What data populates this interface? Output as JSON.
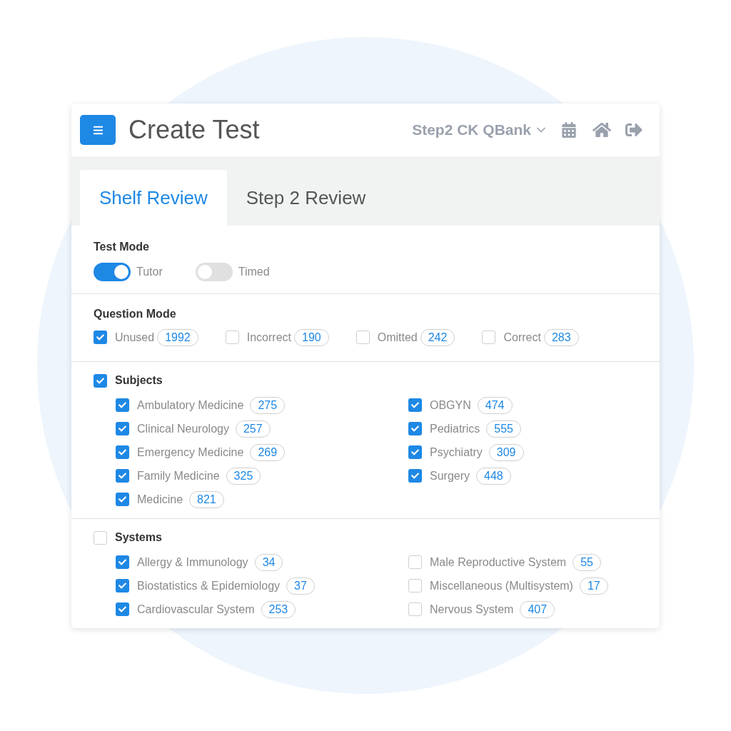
{
  "header": {
    "title": "Create Test",
    "qbank_selector": "Step2 CK QBank"
  },
  "tabs": [
    {
      "label": "Shelf Review",
      "selected": true
    },
    {
      "label": "Step 2 Review",
      "selected": false
    }
  ],
  "test_mode": {
    "label": "Test Mode",
    "options": [
      {
        "label": "Tutor",
        "on": true
      },
      {
        "label": "Timed",
        "on": false
      }
    ]
  },
  "question_mode": {
    "label": "Question Mode",
    "options": [
      {
        "label": "Unused",
        "count": "1992",
        "checked": true
      },
      {
        "label": "Incorrect",
        "count": "190",
        "checked": false
      },
      {
        "label": "Omitted",
        "count": "242",
        "checked": false
      },
      {
        "label": "Correct",
        "count": "283",
        "checked": false
      }
    ]
  },
  "groups": [
    {
      "label": "Subjects",
      "checked": true,
      "columns": [
        [
          {
            "label": "Ambulatory Medicine",
            "count": "275",
            "checked": true
          },
          {
            "label": "Clinical Neurology",
            "count": "257",
            "checked": true
          },
          {
            "label": "Emergency Medicine",
            "count": "269",
            "checked": true
          },
          {
            "label": "Family Medicine",
            "count": "325",
            "checked": true
          },
          {
            "label": "Medicine",
            "count": "821",
            "checked": true
          }
        ],
        [
          {
            "label": "OBGYN",
            "count": "474",
            "checked": true
          },
          {
            "label": "Pediatrics",
            "count": "555",
            "checked": true
          },
          {
            "label": "Psychiatry",
            "count": "309",
            "checked": true
          },
          {
            "label": "Surgery",
            "count": "448",
            "checked": true
          }
        ]
      ]
    },
    {
      "label": "Systems",
      "checked": false,
      "columns": [
        [
          {
            "label": "Allergy & Immunology",
            "count": "34",
            "checked": true
          },
          {
            "label": "Biostatistics & Epidemiology",
            "count": "37",
            "checked": true
          },
          {
            "label": "Cardiovascular System",
            "count": "253",
            "checked": true
          }
        ],
        [
          {
            "label": "Male Reproductive System",
            "count": "55",
            "checked": false
          },
          {
            "label": "Miscellaneous (Multisystem)",
            "count": "17",
            "checked": false
          },
          {
            "label": "Nervous System",
            "count": "407",
            "checked": false
          }
        ]
      ]
    }
  ]
}
